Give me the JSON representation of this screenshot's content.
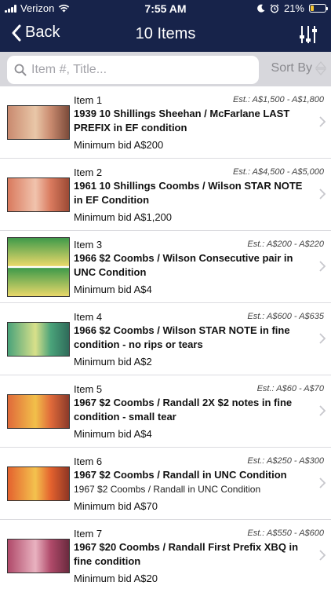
{
  "status_bar": {
    "carrier": "Verizon",
    "time": "7:55 AM",
    "battery": "21%",
    "battery_level": 0.21,
    "icons": [
      "signal-icon",
      "wifi-icon",
      "moon-icon",
      "alarm-icon",
      "battery-icon"
    ]
  },
  "nav": {
    "back_label": "Back",
    "title": "10 Items",
    "filter_icon": "sliders-icon"
  },
  "search": {
    "placeholder": "Item #, Title...",
    "value": "",
    "sort_label": "Sort By"
  },
  "items": [
    {
      "item_no": "Item 1",
      "estimate": "Est.: A$1,500 - A$1,800",
      "title": "1939 10 Shillings Sheehan / McFarlane LAST PREFIX in EF condition",
      "subtitle": "",
      "min_bid": "Minimum bid A$200",
      "thumb_colors": [
        "#c98a6f",
        "#e9c7a8",
        "#7b4b3a"
      ]
    },
    {
      "item_no": "Item 2",
      "estimate": "Est.: A$4,500 - A$5,000",
      "title": "1961 10 Shillings Coombs / Wilson STAR NOTE in EF Condition",
      "subtitle": "",
      "min_bid": "Minimum bid A$1,200",
      "thumb_colors": [
        "#d97a5e",
        "#f1c3ad",
        "#9c4a35"
      ]
    },
    {
      "item_no": "Item 3",
      "estimate": "Est.: A$200 - A$220",
      "title": "1966 $2 Coombs / Wilson Consecutive pair in UNC Condition",
      "subtitle": "",
      "min_bid": "Minimum bid A$4",
      "thumb_colors": [
        "#3f9a4a",
        "#e8d86a",
        "#2a5a2e"
      ]
    },
    {
      "item_no": "Item 4",
      "estimate": "Est.: A$600 - A$635",
      "title": "1966 $2 Coombs / Wilson STAR NOTE in fine condition - no rips or tears",
      "subtitle": "",
      "min_bid": "Minimum bid A$2",
      "thumb_colors": [
        "#4aa37a",
        "#d8e08a",
        "#2f6b5a"
      ]
    },
    {
      "item_no": "Item 5",
      "estimate": "Est.: A$60 - A$70",
      "title": "1967 $2 Coombs / Randall 2X $2 notes in fine condition - small tear",
      "subtitle": "",
      "min_bid": "Minimum bid A$4",
      "thumb_colors": [
        "#e06a3a",
        "#f2c04a",
        "#8a3a2a"
      ]
    },
    {
      "item_no": "Item 6",
      "estimate": "Est.: A$250 - A$300",
      "title": "1967 $2 Coombs / Randall in UNC Condition",
      "subtitle": "1967 $2 Coombs / Randall in UNC Condition",
      "min_bid": "Minimum bid A$70",
      "thumb_colors": [
        "#e4622e",
        "#f4c24e",
        "#8e3624"
      ]
    },
    {
      "item_no": "Item 7",
      "estimate": "Est.: A$550 - A$600",
      "title": "1967 $20 Coombs / Randall First Prefix XBQ in fine condition",
      "subtitle": "",
      "min_bid": "Minimum bid A$20",
      "thumb_colors": [
        "#b04a6a",
        "#e9b2c0",
        "#6a2a3e"
      ]
    }
  ]
}
